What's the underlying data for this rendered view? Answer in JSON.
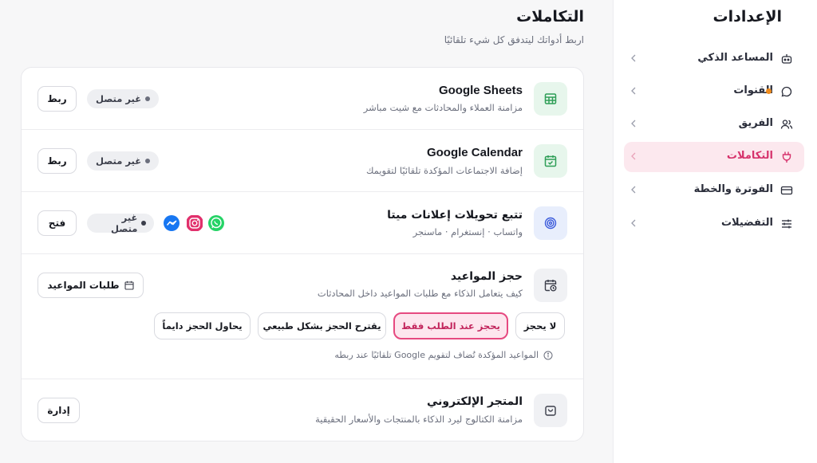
{
  "sidebar": {
    "title": "الإعدادات",
    "items": [
      {
        "label": "المساعد الذكي",
        "icon": "robot-icon",
        "active": false
      },
      {
        "label": "القنوات",
        "icon": "chat-bubble-icon",
        "active": false,
        "dot": true
      },
      {
        "label": "الفريق",
        "icon": "users-icon",
        "active": false
      },
      {
        "label": "التكاملات",
        "icon": "plug-icon",
        "active": true
      },
      {
        "label": "الفوترة والخطة",
        "icon": "credit-card-icon",
        "active": false
      },
      {
        "label": "التفضيلات",
        "icon": "sliders-icon",
        "active": false
      }
    ]
  },
  "header": {
    "title": "التكاملات",
    "subtitle": "اربط أدواتك ليتدفق كل شيء تلقائيًا"
  },
  "integrations": {
    "sheets": {
      "title": "Google Sheets",
      "desc": "مزامنة العملاء والمحادثات مع شيت مباشر",
      "status": "غير متصل",
      "action": "ربط",
      "icon": "table-icon"
    },
    "calendar": {
      "title": "Google Calendar",
      "desc": "إضافة الاجتماعات المؤكدة تلقائيًا لتقويمك",
      "status": "غير متصل",
      "action": "ربط",
      "icon": "calendar-check-icon"
    },
    "meta": {
      "title": "تتبع تحويلات إعلانات ميتا",
      "desc": "واتساب · إنستغرام · ماسنجر",
      "status": "غير متصل",
      "action": "فتح",
      "icon": "target-icon",
      "channels": [
        "whatsapp-icon",
        "instagram-icon",
        "messenger-icon"
      ]
    },
    "booking": {
      "title": "حجز المواعيد",
      "desc": "كيف يتعامل الذكاء مع طلبات المواعيد داخل المحادثات",
      "requests_button": "طلبات المواعيد",
      "icon": "calendar-clock-icon",
      "options": [
        "لا يحجز",
        "يحجز عند الطلب فقط",
        "يقترح الحجز بشكل طبيعي",
        "يحاول الحجز دايماً"
      ],
      "selected_option": "يحجز عند الطلب فقط",
      "note": "المواعيد المؤكدة تُضاف لتقويم Google تلقائيًا عند ربطه"
    },
    "store": {
      "title": "المتجر الإلكتروني",
      "desc": "مزامنة الكتالوج ليرد الذكاء بالمنتجات والأسعار الحقيقية",
      "action": "إدارة",
      "icon": "shopping-bag-icon"
    }
  },
  "colors": {
    "accent": "#e64980",
    "active_bg": "#fce8ee",
    "green_icon_bg": "#e7f6ec",
    "blue_icon_bg": "#e8eefc",
    "gray_icon_bg": "#f0f1f4",
    "notification_dot": "#f08c1d"
  }
}
